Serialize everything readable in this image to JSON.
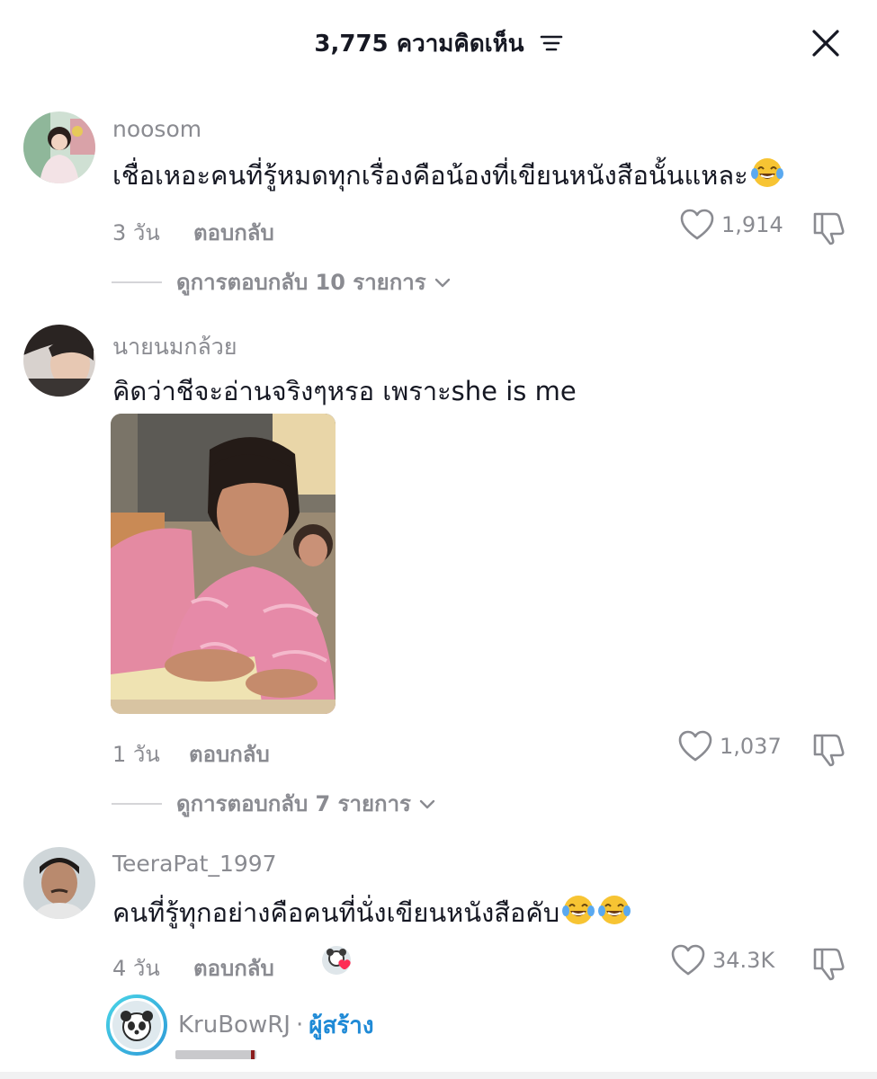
{
  "header": {
    "title": "3,775 ความคิดเห็น"
  },
  "comments": [
    {
      "username": "noosom",
      "text": "เชื่อเหอะคนที่รู้หมดทุกเรื่องคือน้องที่เขียนหนังสือนั้นแหละ",
      "emoji": "face-with-tears-of-joy",
      "time": "3 วัน",
      "reply_label": "ตอบกลับ",
      "likes": "1,914",
      "view_replies": "ดูการตอบกลับ 10 รายการ"
    },
    {
      "username": "นายนมกล้วย",
      "text": "คิดว่าชีจะอ่านจริงๆหรอ เพราะshe is me",
      "time": "1 วัน",
      "reply_label": "ตอบกลับ",
      "likes": "1,037",
      "view_replies": "ดูการตอบกลับ 7 รายการ"
    },
    {
      "username": "TeeraPat_1997",
      "text": "คนที่รู้ทุกอย่างคือคนที่นั่งเขียนหนังสือคับ",
      "emoji": "face-with-tears-of-joy",
      "time": "4 วัน",
      "reply_label": "ตอบกลับ",
      "likes": "34.3K"
    }
  ],
  "creator": {
    "name": "KruBowRJ",
    "separator": "·",
    "badge": "ผู้สร้าง"
  },
  "colors": {
    "text": "#161823",
    "muted": "#8a8b91",
    "creator_badge": "#1f8ad6",
    "heart": "#fe2c55"
  }
}
